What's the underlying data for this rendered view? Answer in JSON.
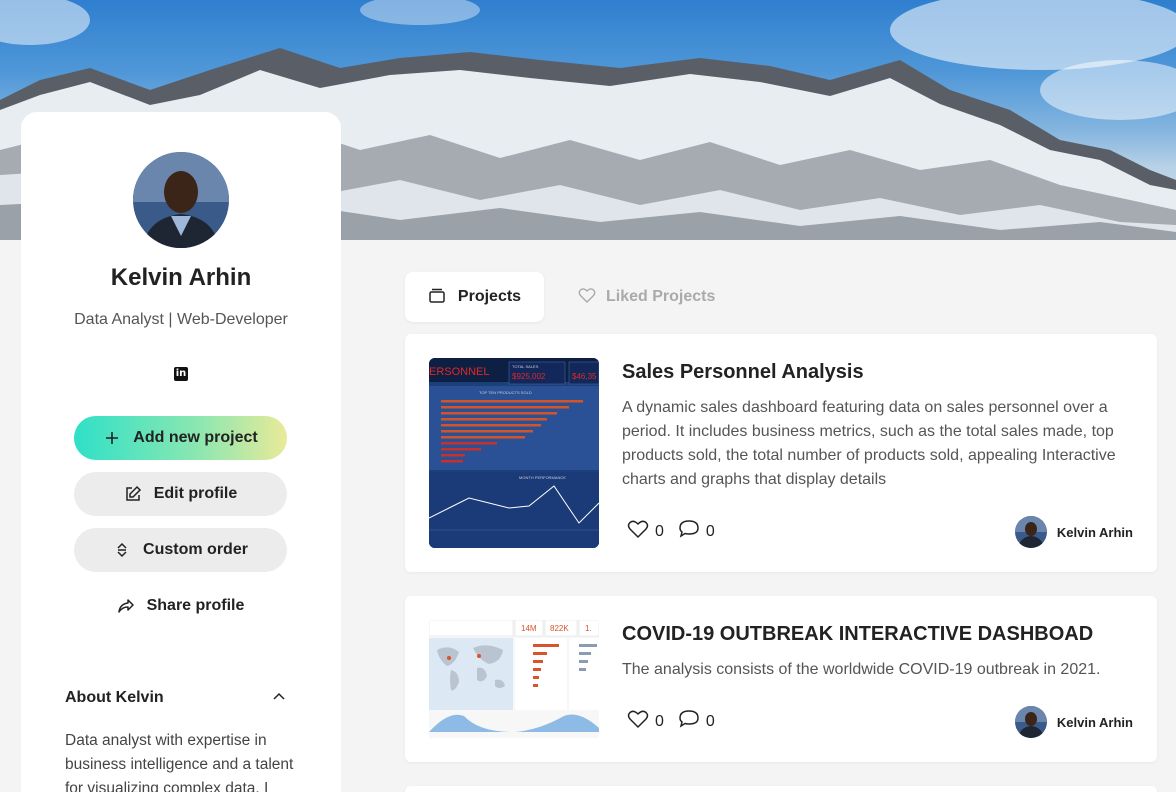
{
  "profile": {
    "name": "Kelvin Arhin",
    "role": "Data Analyst | Web-Developer",
    "social_icon": "linkedin-icon"
  },
  "actions": {
    "add_label": "Add new project",
    "edit_label": "Edit profile",
    "custom_label": "Custom order",
    "share_label": "Share profile"
  },
  "about": {
    "title": "About Kelvin",
    "text": "Data analyst with expertise in business intelligence and a talent for visualizing complex data. I"
  },
  "tabs": {
    "projects": "Projects",
    "liked": "Liked Projects"
  },
  "projects": [
    {
      "title": "Sales Personnel Analysis",
      "description": "A dynamic sales dashboard featuring data on sales personnel over a period. It includes business metrics, such as the total sales made, top products sold, the total number of products sold, appealing Interactive charts and graphs that display details",
      "likes": "0",
      "comments": "0",
      "author": "Kelvin Arhin",
      "thumb_heading": "ERSONNEL",
      "thumb_value_1": "$925,002",
      "thumb_value_2": "$46,35",
      "thumb_caption": "TOP TEN PRODUCTS SOLD",
      "thumb_caption_2": "MONTH PERFORMANCE",
      "thumb_metric_label": "TOTAL SALES"
    },
    {
      "title": "COVID-19 OUTBREAK INTERACTIVE DASHBOAD",
      "description": "The analysis consists of the worldwide COVID-19 outbreak in 2021.",
      "likes": "0",
      "comments": "0",
      "author": "Kelvin Arhin",
      "thumb_stat_1": "14M",
      "thumb_stat_2": "822K",
      "thumb_stat_3": "1."
    }
  ],
  "colors": {
    "accent_start": "#2fe0c8",
    "accent_end": "#e9ea98",
    "dashboard_blue": "#1d3f7a",
    "dashboard_red": "#e02828"
  }
}
